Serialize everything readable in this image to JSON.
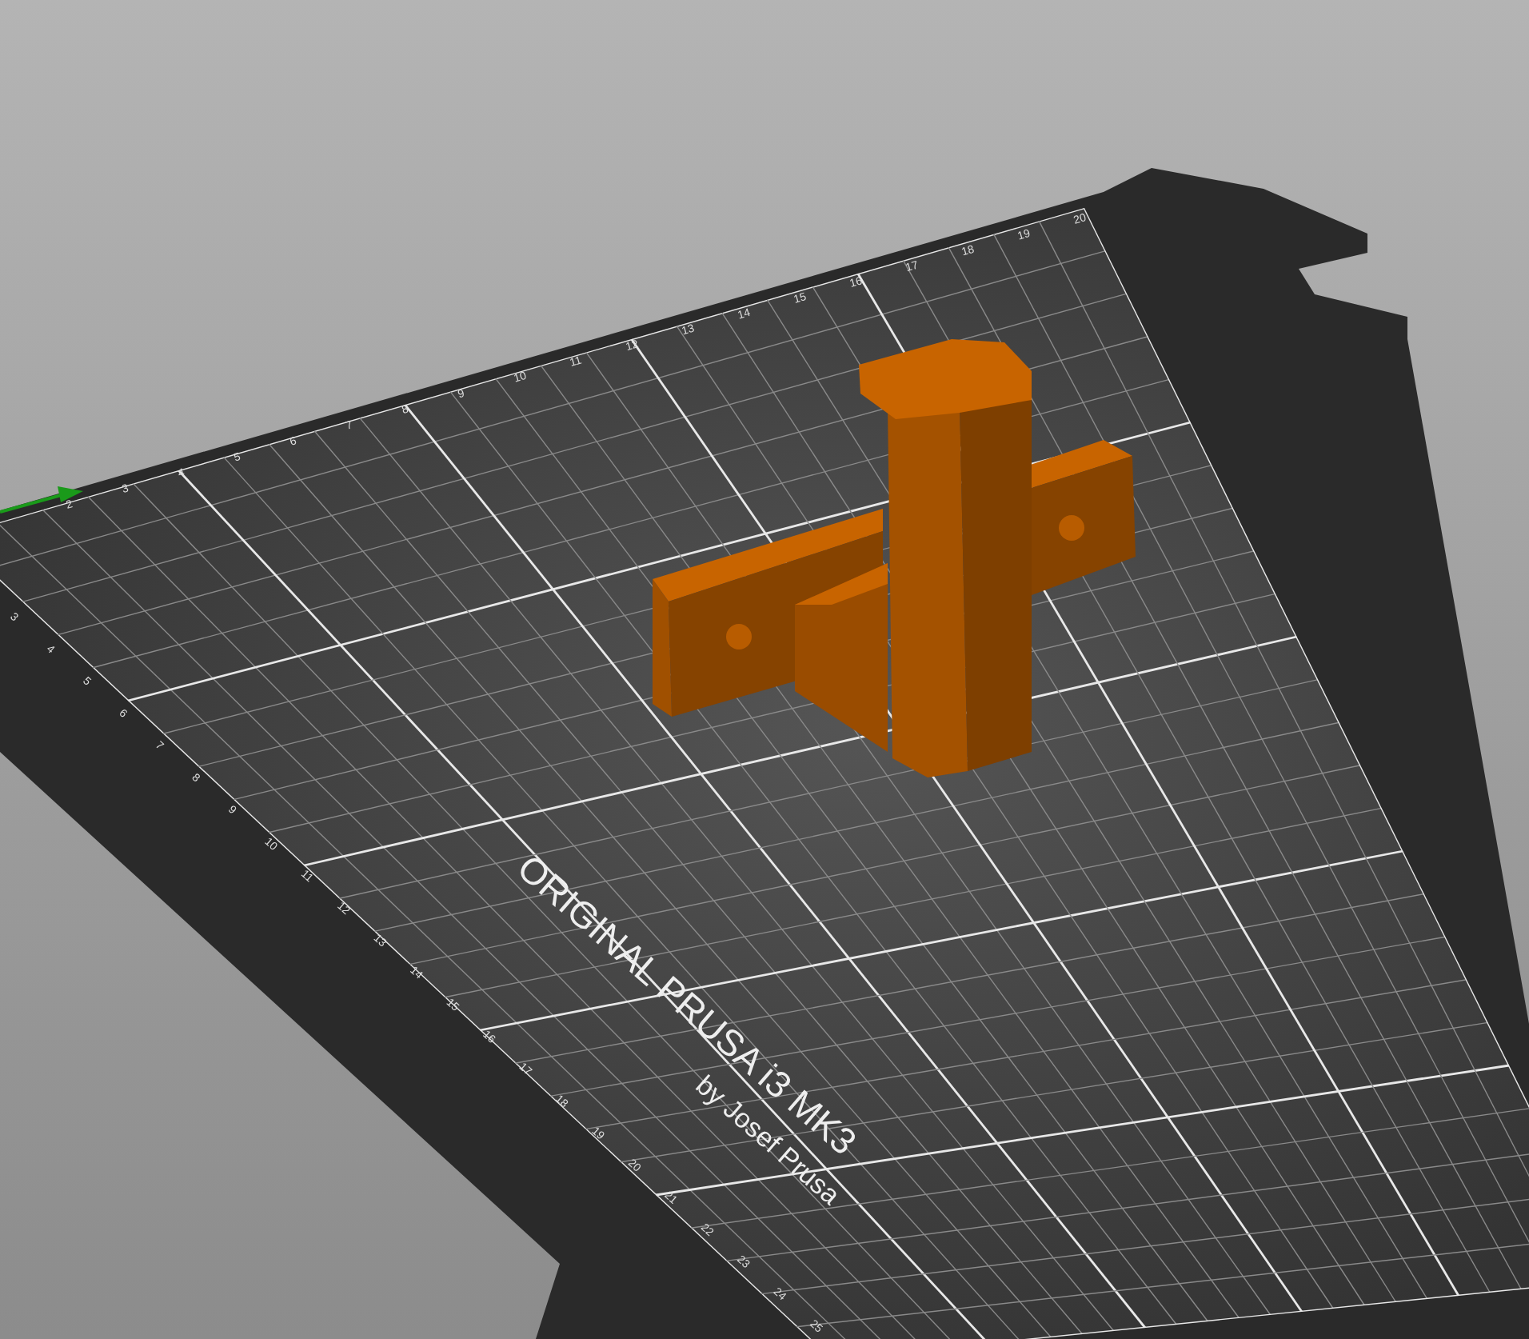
{
  "bed": {
    "top_axis_labels": [
      "2",
      "3",
      "4",
      "5",
      "6",
      "7",
      "8",
      "9",
      "10",
      "11",
      "12",
      "13",
      "14",
      "15",
      "16",
      "17",
      "18",
      "19",
      "20"
    ],
    "left_axis_labels": [
      "3",
      "4",
      "5",
      "6",
      "7",
      "8",
      "9",
      "10",
      "11",
      "12",
      "13",
      "14",
      "15",
      "16",
      "17",
      "18",
      "19",
      "20",
      "21",
      "22",
      "23",
      "24",
      "25"
    ],
    "logo": {
      "title": "ORIGINAL PRUSA i3 MK3",
      "subtitle": "by Josef Prusa"
    }
  }
}
